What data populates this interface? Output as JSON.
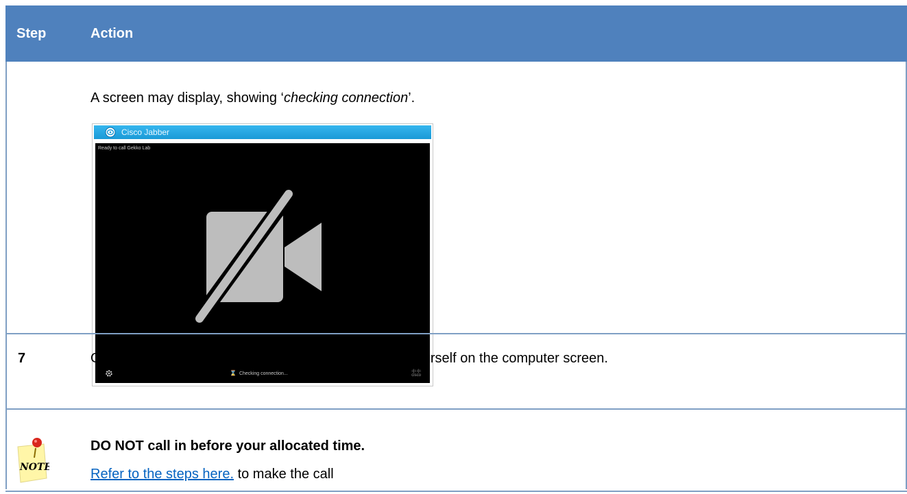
{
  "header": {
    "step": "Step",
    "action": "Action"
  },
  "row_screenshot": {
    "description_prefix": "A screen may display, showing ‘",
    "description_italic": "checking connection",
    "description_suffix": "’.",
    "jabber": {
      "title": "Cisco Jabber",
      "ready_text": "Ready to call Gekko Lab",
      "status_text": "Checking connection...",
      "brand_line1": "·ı|ı·ı|ı·",
      "brand_line2": "cisco"
    }
  },
  "row_step7": {
    "number": "7",
    "text": "Once the page reloads, you should see an image of yourself on the computer screen."
  },
  "note": {
    "icon_text": "NOTE",
    "bold_text": "DO NOT call in before your allocated time.",
    "link_text": "Refer to the steps here.",
    "after_link": " to make the call"
  },
  "colors": {
    "header_bg": "#4f81bd",
    "border": "#7f9fc4",
    "jabber_titlebar": "#1a9ad7",
    "link": "#0563c1"
  }
}
